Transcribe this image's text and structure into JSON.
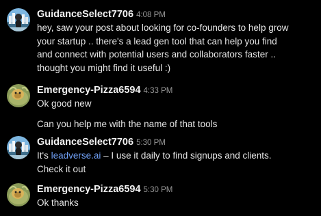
{
  "messages": [
    {
      "username": "GuidanceSelect7706",
      "time": "4:08 PM",
      "avatar_icon": "snoo-avatar-city",
      "lines": [
        "hey, saw your post about looking for co-founders to help grow",
        "your startup .. there's a lead gen tool that can help you find",
        "and connect with potential users and collaborators faster ..",
        "thought you might find it useful :)"
      ]
    },
    {
      "username": "Emergency-Pizza6594",
      "time": "4:33 PM",
      "avatar_icon": "snoo-avatar-leaf",
      "lines": [
        "Ok good new"
      ]
    },
    {
      "continuation_text": "Can you help me with the name of that tools"
    },
    {
      "username": "GuidanceSelect7706",
      "time": "5:30 PM",
      "avatar_icon": "snoo-avatar-city",
      "prefix": "It's ",
      "link": "leadverse.ai",
      "suffix": " – I use it daily to find signups and clients.",
      "line2": "Check it out"
    },
    {
      "username": "Emergency-Pizza6594",
      "time": "5:30 PM",
      "avatar_icon": "snoo-avatar-leaf",
      "lines": [
        "Ok thanks"
      ]
    }
  ],
  "colors": {
    "background": "#000000",
    "link": "#6f9ff5",
    "timestamp": "#9a9a9a"
  }
}
